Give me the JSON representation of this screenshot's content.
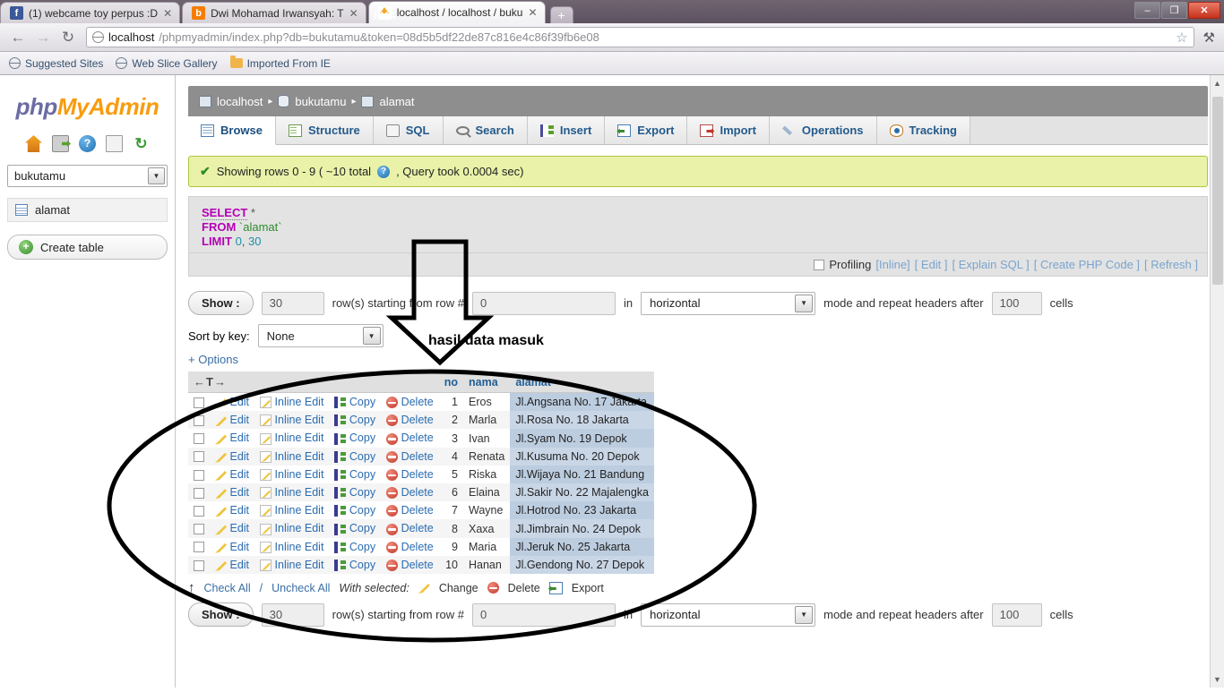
{
  "browser": {
    "tabs": [
      {
        "title": "(1) webcame toy perpus :D",
        "favicon": "facebook-icon",
        "active": false
      },
      {
        "title": "Dwi Mohamad Irwansyah: T",
        "favicon": "blogger-icon",
        "active": false
      },
      {
        "title": "localhost / localhost / buku",
        "favicon": "phpmyadmin-icon",
        "active": true
      }
    ],
    "new_tab_label": "+",
    "window_controls": {
      "minimize": "–",
      "maximize": "❐",
      "close": "✕"
    },
    "nav": {
      "back": "←",
      "forward": "→",
      "reload": "↻"
    },
    "url_host": "localhost",
    "url_rest": "/phpmyadmin/index.php?db=bukutamu&token=08d5b5df22de87c816e4c86f39fb6e08",
    "star_icon": "☆",
    "wrench_icon": "⚒",
    "bookmarks": [
      {
        "label": "Suggested Sites",
        "icon": "globe-icon"
      },
      {
        "label": "Web Slice Gallery",
        "icon": "globe-icon"
      },
      {
        "label": "Imported From IE",
        "icon": "folder-icon"
      }
    ]
  },
  "sidebar": {
    "logo_part1": "php",
    "logo_part2": "MyAdmin",
    "icons": [
      {
        "name": "home-icon",
        "glyph": ""
      },
      {
        "name": "logout-icon",
        "glyph": ""
      },
      {
        "name": "help-icon",
        "glyph": "?"
      },
      {
        "name": "docs-icon",
        "glyph": ""
      },
      {
        "name": "reload-icon",
        "glyph": "↺"
      }
    ],
    "database_selected": "bukutamu",
    "tables": [
      {
        "label": "alamat",
        "icon": "table-icon"
      }
    ],
    "create_table_label": "Create table"
  },
  "breadcrumb": {
    "server": "localhost",
    "database": "bukutamu",
    "table": "alamat",
    "separator": "▸"
  },
  "tabs": [
    {
      "label": "Browse",
      "icon": "browse-icon",
      "active": true
    },
    {
      "label": "Structure",
      "icon": "structure-icon",
      "active": false
    },
    {
      "label": "SQL",
      "icon": "sql-icon",
      "active": false
    },
    {
      "label": "Search",
      "icon": "search-icon",
      "active": false
    },
    {
      "label": "Insert",
      "icon": "insert-icon",
      "active": false
    },
    {
      "label": "Export",
      "icon": "export-icon",
      "active": false
    },
    {
      "label": "Import",
      "icon": "import-icon",
      "active": false
    },
    {
      "label": "Operations",
      "icon": "operations-icon",
      "active": false
    },
    {
      "label": "Tracking",
      "icon": "tracking-icon",
      "active": false
    }
  ],
  "status": {
    "check_icon": "✔",
    "text_before": "Showing rows 0 - 9 ( ~10 total",
    "help_icon": "?",
    "text_after": ", Query took 0.0004 sec)"
  },
  "sql": {
    "keyword_select": "SELECT",
    "star": "*",
    "keyword_from": "FROM",
    "table_ref": "`alamat`",
    "keyword_limit": "LIMIT",
    "limit_start": "0",
    "limit_comma": ",",
    "limit_count": "30"
  },
  "profiling": {
    "label": "Profiling",
    "links": [
      "[Inline]",
      "[ Edit ]",
      "[ Explain SQL ]",
      "[ Create PHP Code ]",
      "[ Refresh ]"
    ]
  },
  "controls_top": {
    "show_button": "Show :",
    "rows_value": "30",
    "rows_label": "row(s) starting from row #",
    "start_row_value": "0",
    "in_label": "in",
    "mode_value": "horizontal",
    "mode_label": "mode and repeat headers after",
    "headers_value": "100",
    "cells_label": "cells"
  },
  "sort": {
    "label": "Sort by key:",
    "value": "None",
    "options_link": "+ Options"
  },
  "table": {
    "sort_icon": "←T→",
    "columns": [
      "no",
      "nama",
      "alamat"
    ],
    "actions": [
      "Edit",
      "Inline Edit",
      "Copy",
      "Delete"
    ],
    "rows": [
      {
        "no": "1",
        "nama": "Eros",
        "alamat": "Jl.Angsana No. 17 Jakarta"
      },
      {
        "no": "2",
        "nama": "Marla",
        "alamat": "Jl.Rosa No. 18 Jakarta"
      },
      {
        "no": "3",
        "nama": "Ivan",
        "alamat": "Jl.Syam No. 19 Depok"
      },
      {
        "no": "4",
        "nama": "Renata",
        "alamat": "Jl.Kusuma No. 20 Depok"
      },
      {
        "no": "5",
        "nama": "Riska",
        "alamat": "Jl.Wijaya No. 21 Bandung"
      },
      {
        "no": "6",
        "nama": "Elaina",
        "alamat": "Jl.Sakir No. 22 Majalengka"
      },
      {
        "no": "7",
        "nama": "Wayne",
        "alamat": "Jl.Hotrod No. 23 Jakarta"
      },
      {
        "no": "8",
        "nama": "Xaxa",
        "alamat": "Jl.Jimbrain No. 24 Depok"
      },
      {
        "no": "9",
        "nama": "Maria",
        "alamat": "Jl.Jeruk No. 25 Jakarta"
      },
      {
        "no": "10",
        "nama": "Hanan",
        "alamat": "Jl.Gendong No. 27 Depok"
      }
    ]
  },
  "bottom_actions": {
    "arrow": "↑",
    "check_all": "Check All",
    "slash": "/",
    "uncheck_all": "Uncheck All",
    "with_selected": "With selected:",
    "change": "Change",
    "delete": "Delete",
    "export": "Export"
  },
  "controls_bottom": {
    "show_button": "Show :",
    "rows_value": "30",
    "rows_label": "row(s) starting from row #",
    "start_row_value": "0",
    "in_label": "in",
    "mode_value": "horizontal",
    "mode_label": "mode and repeat headers after",
    "headers_value": "100",
    "cells_label": "cells"
  },
  "annotation": {
    "label": "hasil data masuk"
  },
  "colors": {
    "accent_blue": "#2b6cb0",
    "status_bg": "#e9f2a8",
    "breadcrumb_bg": "#8e8e8e",
    "alamat_cell": "#bdcde0",
    "logo_orange": "#f89c0e",
    "logo_purple": "#6c6ca4"
  }
}
